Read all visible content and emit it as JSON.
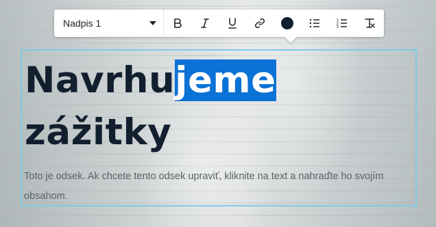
{
  "toolbar": {
    "style_select": "Nadpis 1",
    "buttons": [
      {
        "name": "bold-button",
        "icon": "bold-icon"
      },
      {
        "name": "italic-button",
        "icon": "italic-icon"
      },
      {
        "name": "underline-button",
        "icon": "underline-icon"
      },
      {
        "name": "link-button",
        "icon": "link-icon"
      },
      {
        "name": "text-color-button",
        "icon": "color-swatch-icon"
      },
      {
        "name": "bullet-list-button",
        "icon": "bullet-list-icon"
      },
      {
        "name": "numbered-list-button",
        "icon": "numbered-list-icon"
      },
      {
        "name": "clear-format-button",
        "icon": "clear-format-icon"
      }
    ],
    "text_color": "#0f1f2f"
  },
  "editor": {
    "heading_plain": "Navrhu",
    "heading_selected": "jeme",
    "heading_line2": "zážitky",
    "paragraph": "Toto je odsek. Ak chcete tento odsek upraviť, kliknite na text a nahraďte ho svojím obsahom."
  },
  "colors": {
    "selection": "#0b72d6",
    "heading_text": "#111f2f",
    "editor_border": "#7ecbe6"
  }
}
